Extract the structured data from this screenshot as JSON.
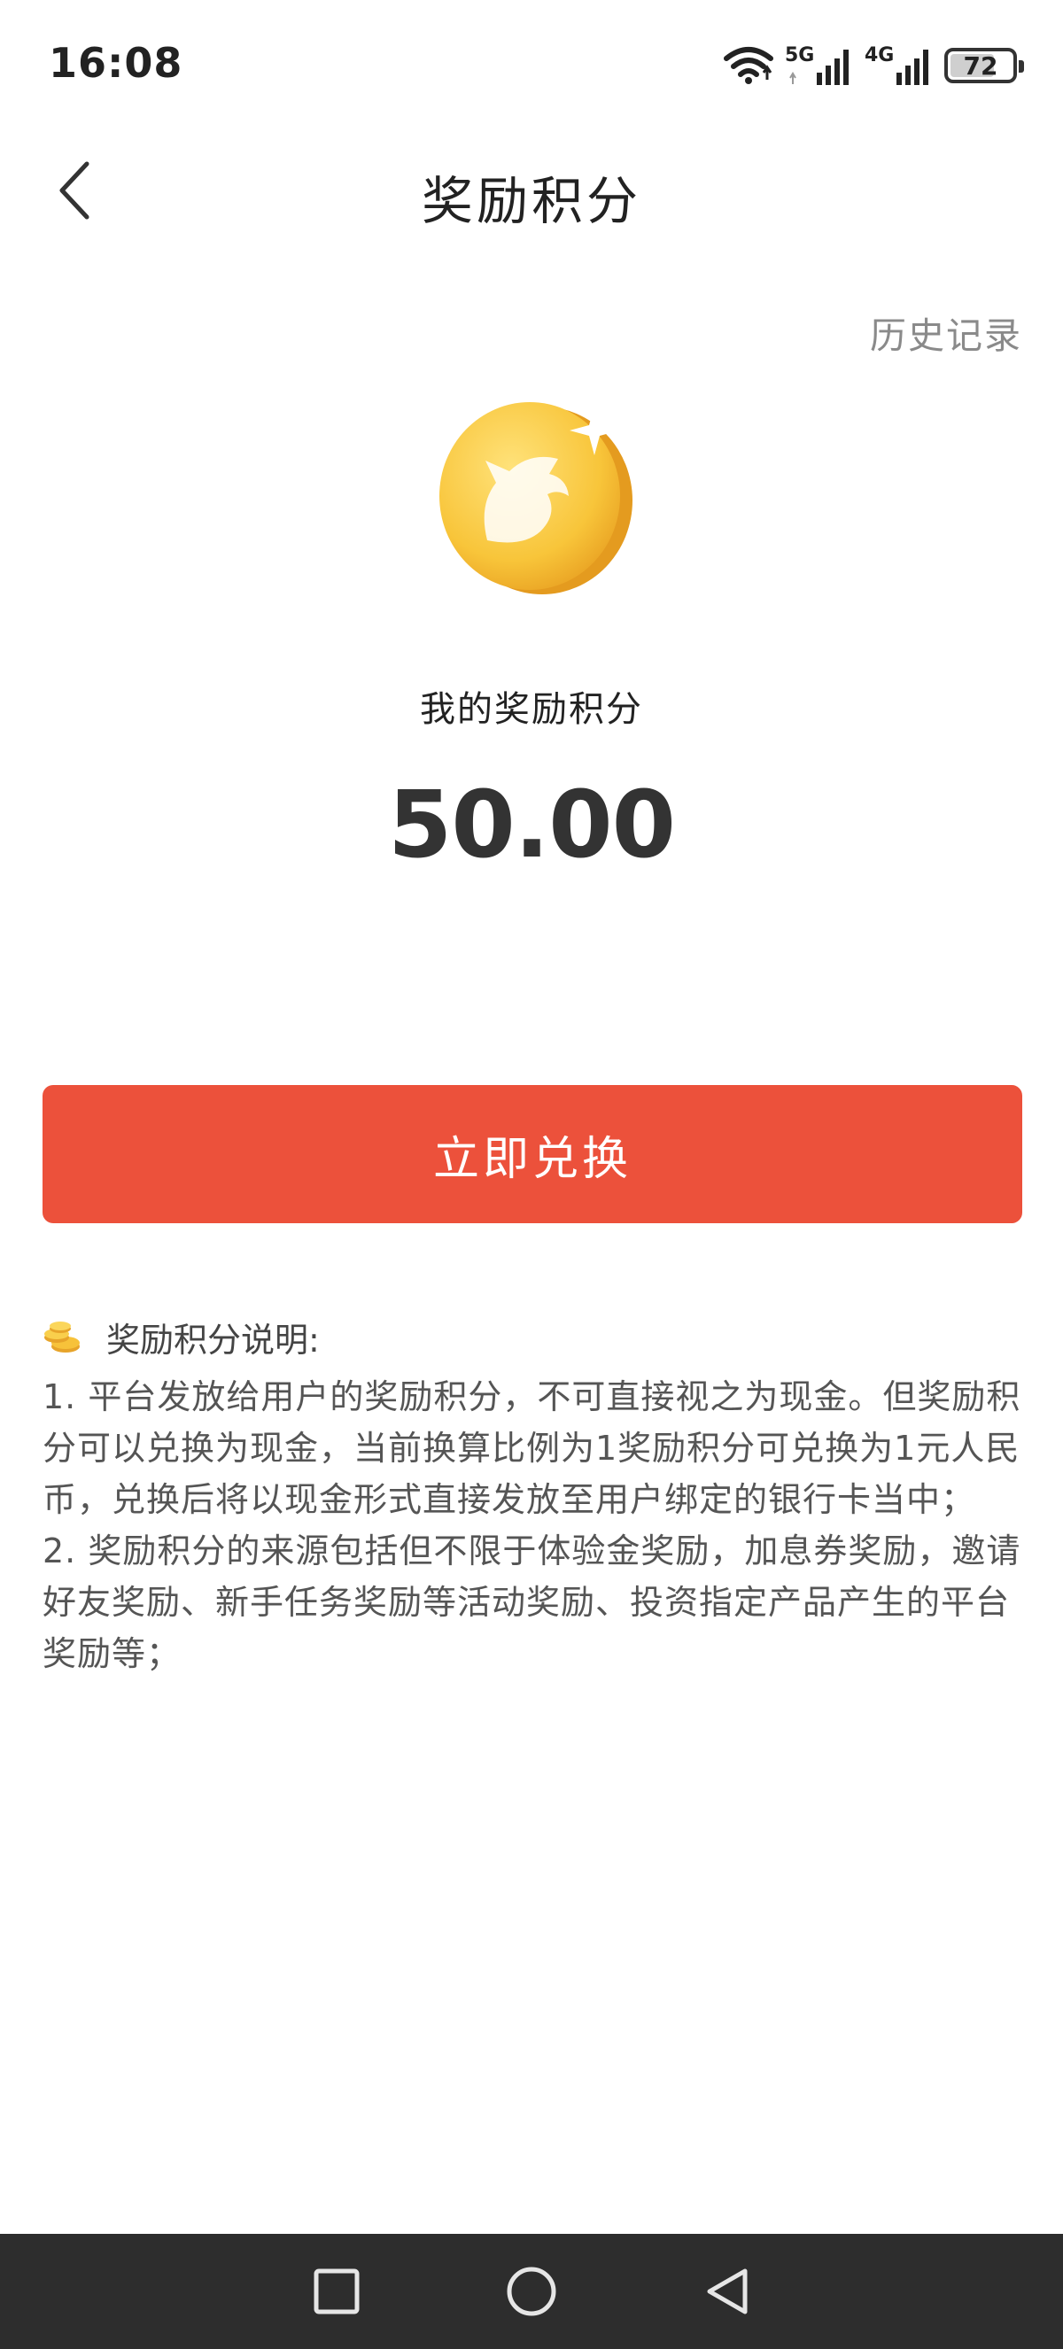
{
  "status_bar": {
    "time": "16:08",
    "signal_1_label": "5G",
    "signal_2_label": "4G",
    "battery_level": "72",
    "battery_fraction": 0.72,
    "icons": [
      "wifi-icon",
      "signal-5g-icon",
      "signal-4g-icon",
      "battery-icon"
    ]
  },
  "nav": {
    "title": "奖励积分",
    "back_icon": "chevron-left-icon"
  },
  "history_link": "历史记录",
  "points": {
    "label": "我的奖励积分",
    "value": "50.00"
  },
  "exchange_button": "立即兑换",
  "rules": {
    "title": "奖励积分说明:",
    "items": [
      "1. 平台发放给用户的奖励积分，不可直接视之为现金。但奖励积分可以兑换为现金，当前换算比例为1奖励积分可兑换为1元人民币，兑换后将以现金形式直接发放至用户绑定的银行卡当中；",
      "2. 奖励积分的来源包括但不限于体验金奖励，加息券奖励，邀请好友奖励、新手任务奖励等活动奖励、投资指定产品产生的平台奖励等；"
    ]
  },
  "colors": {
    "accent": "#ec513b",
    "coin_gold": "#f7c23a",
    "system_nav": "#2d2d2d"
  }
}
